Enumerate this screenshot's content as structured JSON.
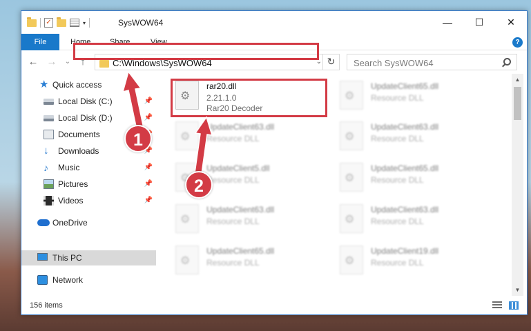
{
  "window": {
    "title": "SysWOW64",
    "controls": {
      "minimize": "—",
      "maximize": "☐",
      "close": "✕"
    }
  },
  "ribbon": {
    "tabs": [
      "File",
      "Home",
      "Share",
      "View"
    ],
    "help": "?"
  },
  "address": {
    "path": "C:\\Windows\\SysWOW64",
    "refresh_icon": "↻"
  },
  "search": {
    "placeholder": "Search SysWOW64"
  },
  "nav_buttons": {
    "back": "←",
    "forward": "→",
    "history": "⌄",
    "up": "↑"
  },
  "sidebar": {
    "items": [
      {
        "label": "Quick access",
        "icon": "star-icon",
        "pinned": false
      },
      {
        "label": "Local Disk (C:)",
        "icon": "disk-icon",
        "pinned": true
      },
      {
        "label": "Local Disk (D:)",
        "icon": "disk-icon",
        "pinned": true
      },
      {
        "label": "Documents",
        "icon": "documents-icon",
        "pinned": true
      },
      {
        "label": "Downloads",
        "icon": "download-icon",
        "pinned": true
      },
      {
        "label": "Music",
        "icon": "music-icon",
        "pinned": true
      },
      {
        "label": "Pictures",
        "icon": "pictures-icon",
        "pinned": true
      },
      {
        "label": "Videos",
        "icon": "videos-icon",
        "pinned": true
      },
      {
        "label": "OneDrive",
        "icon": "cloud-icon",
        "pinned": false
      },
      {
        "label": "This PC",
        "icon": "computer-icon",
        "pinned": false,
        "selected": true
      },
      {
        "label": "Network",
        "icon": "network-icon",
        "pinned": false
      }
    ]
  },
  "files": {
    "highlighted": {
      "name": "rar20.dll",
      "version": "2.21.1.0",
      "description": "Rar20 Decoder"
    },
    "col1": [
      {
        "name": "UpdateClient63.dll",
        "description": "Resource DLL"
      },
      {
        "name": "UpdateClient5.dll",
        "description": "Resource DLL"
      },
      {
        "name": "UpdateClient63.dll",
        "description": "Resource DLL"
      },
      {
        "name": "UpdateClient65.dll",
        "description": "Resource DLL"
      }
    ],
    "col2": [
      {
        "name": "UpdateClient65.dll",
        "description": "Resource DLL"
      },
      {
        "name": "UpdateClient63.dll",
        "description": "Resource DLL"
      },
      {
        "name": "UpdateClient65.dll",
        "description": "Resource DLL"
      },
      {
        "name": "UpdateClient63.dll",
        "description": "Resource DLL"
      },
      {
        "name": "UpdateClient19.dll",
        "description": "Resource DLL"
      }
    ]
  },
  "status": {
    "item_count": "156 items"
  },
  "callouts": {
    "first": "1",
    "second": "2"
  },
  "colors": {
    "accent": "#1979ca",
    "highlight": "#d33b45",
    "selected_bg": "#d9d9d9"
  }
}
